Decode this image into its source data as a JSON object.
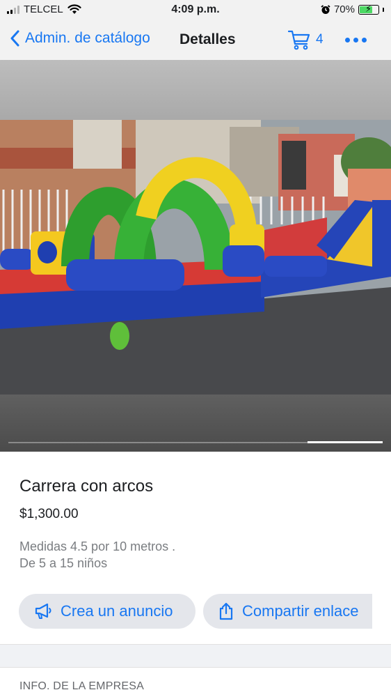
{
  "status_bar": {
    "carrier": "TELCEL",
    "time": "4:09 p.m.",
    "battery_percent": "70%",
    "battery_level": 0.7,
    "icons": [
      "signal-bars-icon",
      "wifi-icon",
      "alarm-icon",
      "battery-charging-icon"
    ]
  },
  "nav": {
    "back_label": "Admin. de catálogo",
    "title": "Detalles",
    "cart_count": "4",
    "icons": [
      "chevron-left-icon",
      "cart-icon",
      "more-icon"
    ]
  },
  "gallery": {
    "image_description_icon": "bouncy-obstacle-course-photo",
    "page_indicator_active": 5,
    "page_indicator_total": 5
  },
  "product": {
    "title": "Carrera con arcos",
    "price": "$1,300.00",
    "description_line1": "Medidas 4.5 por 10 metros .",
    "description_line2": "De 5 a 15 niños"
  },
  "actions": {
    "create_ad_label": "Crea un anuncio",
    "share_label": "Compartir enlace",
    "icons": [
      "megaphone-icon",
      "share-icon"
    ]
  },
  "section": {
    "company_info_header": "INFO. DE LA EMPRESA"
  },
  "colors": {
    "accent": "#1877f2",
    "bar_bg": "#f2f2f2",
    "button_bg": "#e4e6eb",
    "muted_text": "#7a7d81"
  }
}
